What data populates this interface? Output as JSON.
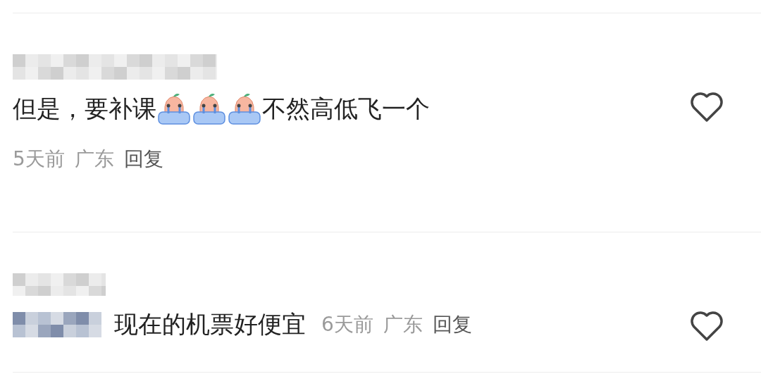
{
  "comments": [
    {
      "kind": "block",
      "liked": false,
      "segments": [
        {
          "kind": "text",
          "text": "但是，要补课"
        },
        {
          "kind": "emoji"
        },
        {
          "kind": "emoji"
        },
        {
          "kind": "emoji"
        },
        {
          "kind": "text",
          "text": "不然高低飞一个"
        }
      ],
      "time": "5天前",
      "location": "广东",
      "reply": "回复"
    },
    {
      "kind": "inline",
      "liked": false,
      "segments": [
        {
          "kind": "mention"
        },
        {
          "kind": "text",
          "text": "现在的机票好便宜"
        }
      ],
      "time": "6天前",
      "location": "广东",
      "reply": "回复"
    }
  ]
}
